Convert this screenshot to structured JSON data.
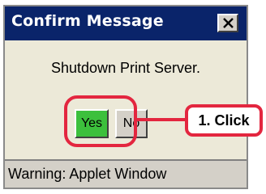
{
  "window": {
    "title": "Confirm Message",
    "message": "Shutdown Print Server."
  },
  "buttons": {
    "yes_label": "Yes",
    "no_label": "No"
  },
  "status": {
    "text": "Warning: Applet Window"
  },
  "annotation": {
    "callout_label": "1. Click",
    "highlight_color": "#e3263f"
  },
  "icons": {
    "close": "close-icon"
  },
  "colors": {
    "titlebar": "#0a246a",
    "yes_button": "#3cc03c"
  }
}
